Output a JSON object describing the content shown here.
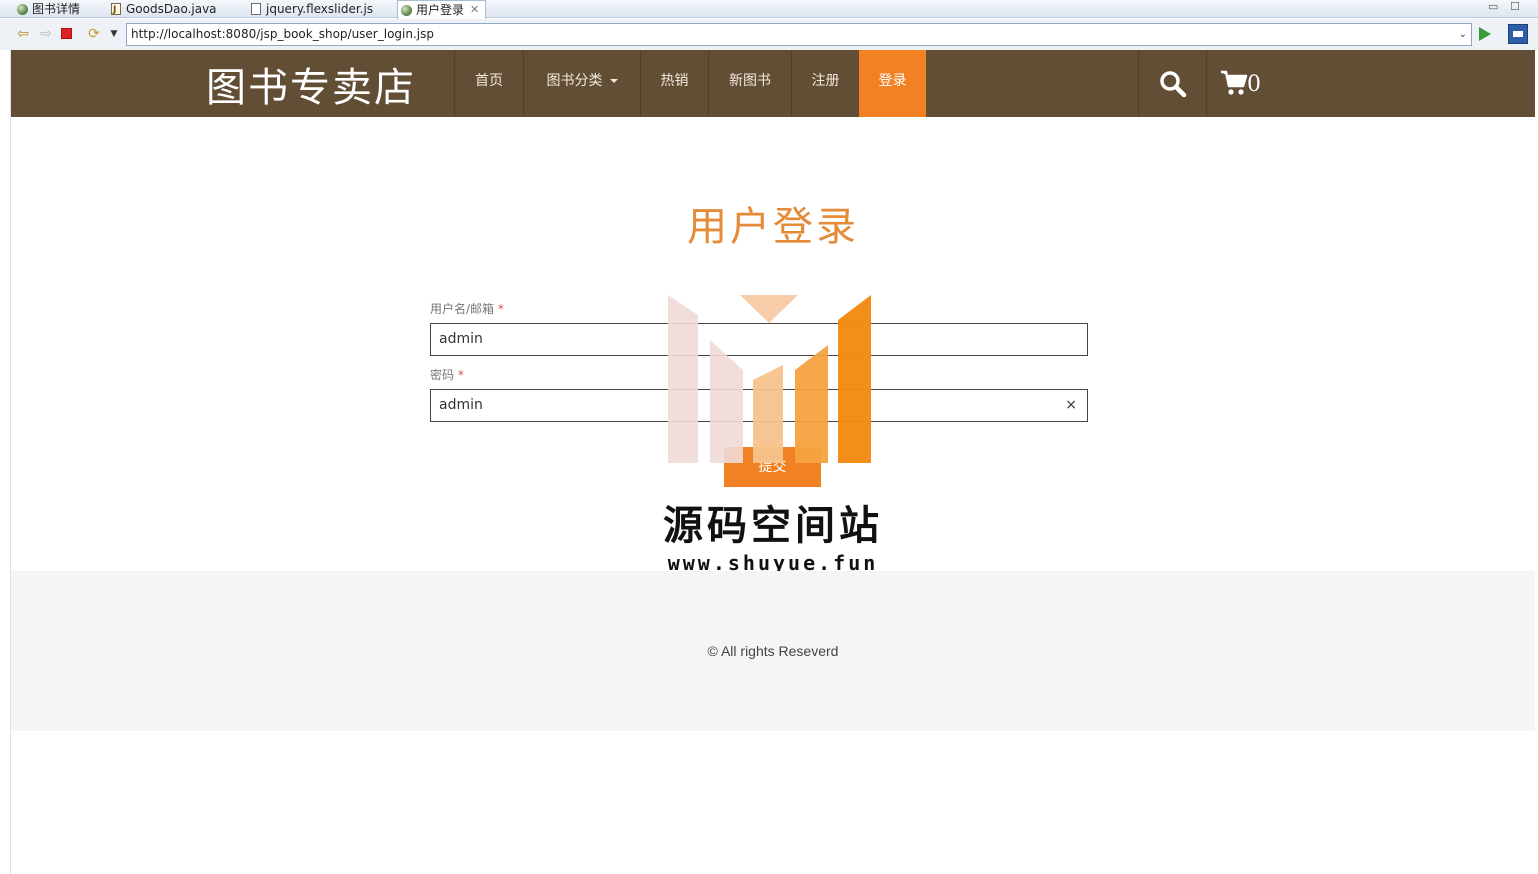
{
  "ide_tabs": [
    {
      "label": "图书详情",
      "icon": "globe-icon"
    },
    {
      "label": "GoodsDao.java",
      "icon": "java-file-icon"
    },
    {
      "label": "jquery.flexslider.js",
      "icon": "js-file-icon"
    },
    {
      "label": "用户登录",
      "icon": "globe-icon",
      "active": true
    }
  ],
  "address_bar": {
    "url": "http://localhost:8080/jsp_book_shop/user_login.jsp"
  },
  "site": {
    "logo": "图书专卖店",
    "nav": {
      "home": "首页",
      "categories": "图书分类",
      "hot": "热销",
      "new": "新图书",
      "register": "注册",
      "login": "登录"
    },
    "cart_count": "0"
  },
  "login": {
    "title": "用户登录",
    "username_label": "用户名/邮箱",
    "username_value": "admin",
    "password_label": "密码",
    "password_value": "admin",
    "required_mark": "*",
    "clear_glyph": "×",
    "submit_label": "提交"
  },
  "watermark": {
    "title": "源码空间站",
    "url": "www.shuyue.fun"
  },
  "footer": {
    "copyright": "© All rights Reseverd"
  },
  "colors": {
    "header_bg": "#614e35",
    "accent": "#f28123",
    "title": "#e58a37",
    "footer_bg": "#f3f5f6"
  }
}
